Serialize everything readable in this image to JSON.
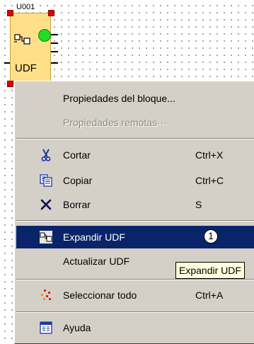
{
  "block": {
    "id_label": "U001",
    "type_label": "UDF",
    "block_icon": "udf-block-icon",
    "status_color": "#22dd22"
  },
  "menu": {
    "properties": "Propiedades del bloque...",
    "remote_properties": "Propiedades remotas···",
    "cut": {
      "label": "Cortar",
      "shortcut": "Ctrl+X",
      "icon": "scissors-icon"
    },
    "copy": {
      "label": "Copiar",
      "shortcut": "Ctrl+C",
      "icon": "copy-icon"
    },
    "delete": {
      "label": "Borrar",
      "shortcut": "S",
      "icon": "delete-x-icon"
    },
    "expand": {
      "label": "Expandir UDF",
      "icon": "expand-udf-icon",
      "badge": "1"
    },
    "update": {
      "label": "Actualizar  UDF"
    },
    "select_all": {
      "label": "Seleccionar todo",
      "shortcut": "Ctrl+A",
      "icon": "select-all-icon"
    },
    "help": {
      "label": "Ayuda",
      "icon": "help-icon"
    }
  },
  "tooltip": {
    "text": "Expandir UDF"
  },
  "colors": {
    "menu_bg": "#d4d0c8",
    "highlight": "#0a246a",
    "tooltip_bg": "#ffffe1",
    "block_fill": "#ffe089"
  }
}
